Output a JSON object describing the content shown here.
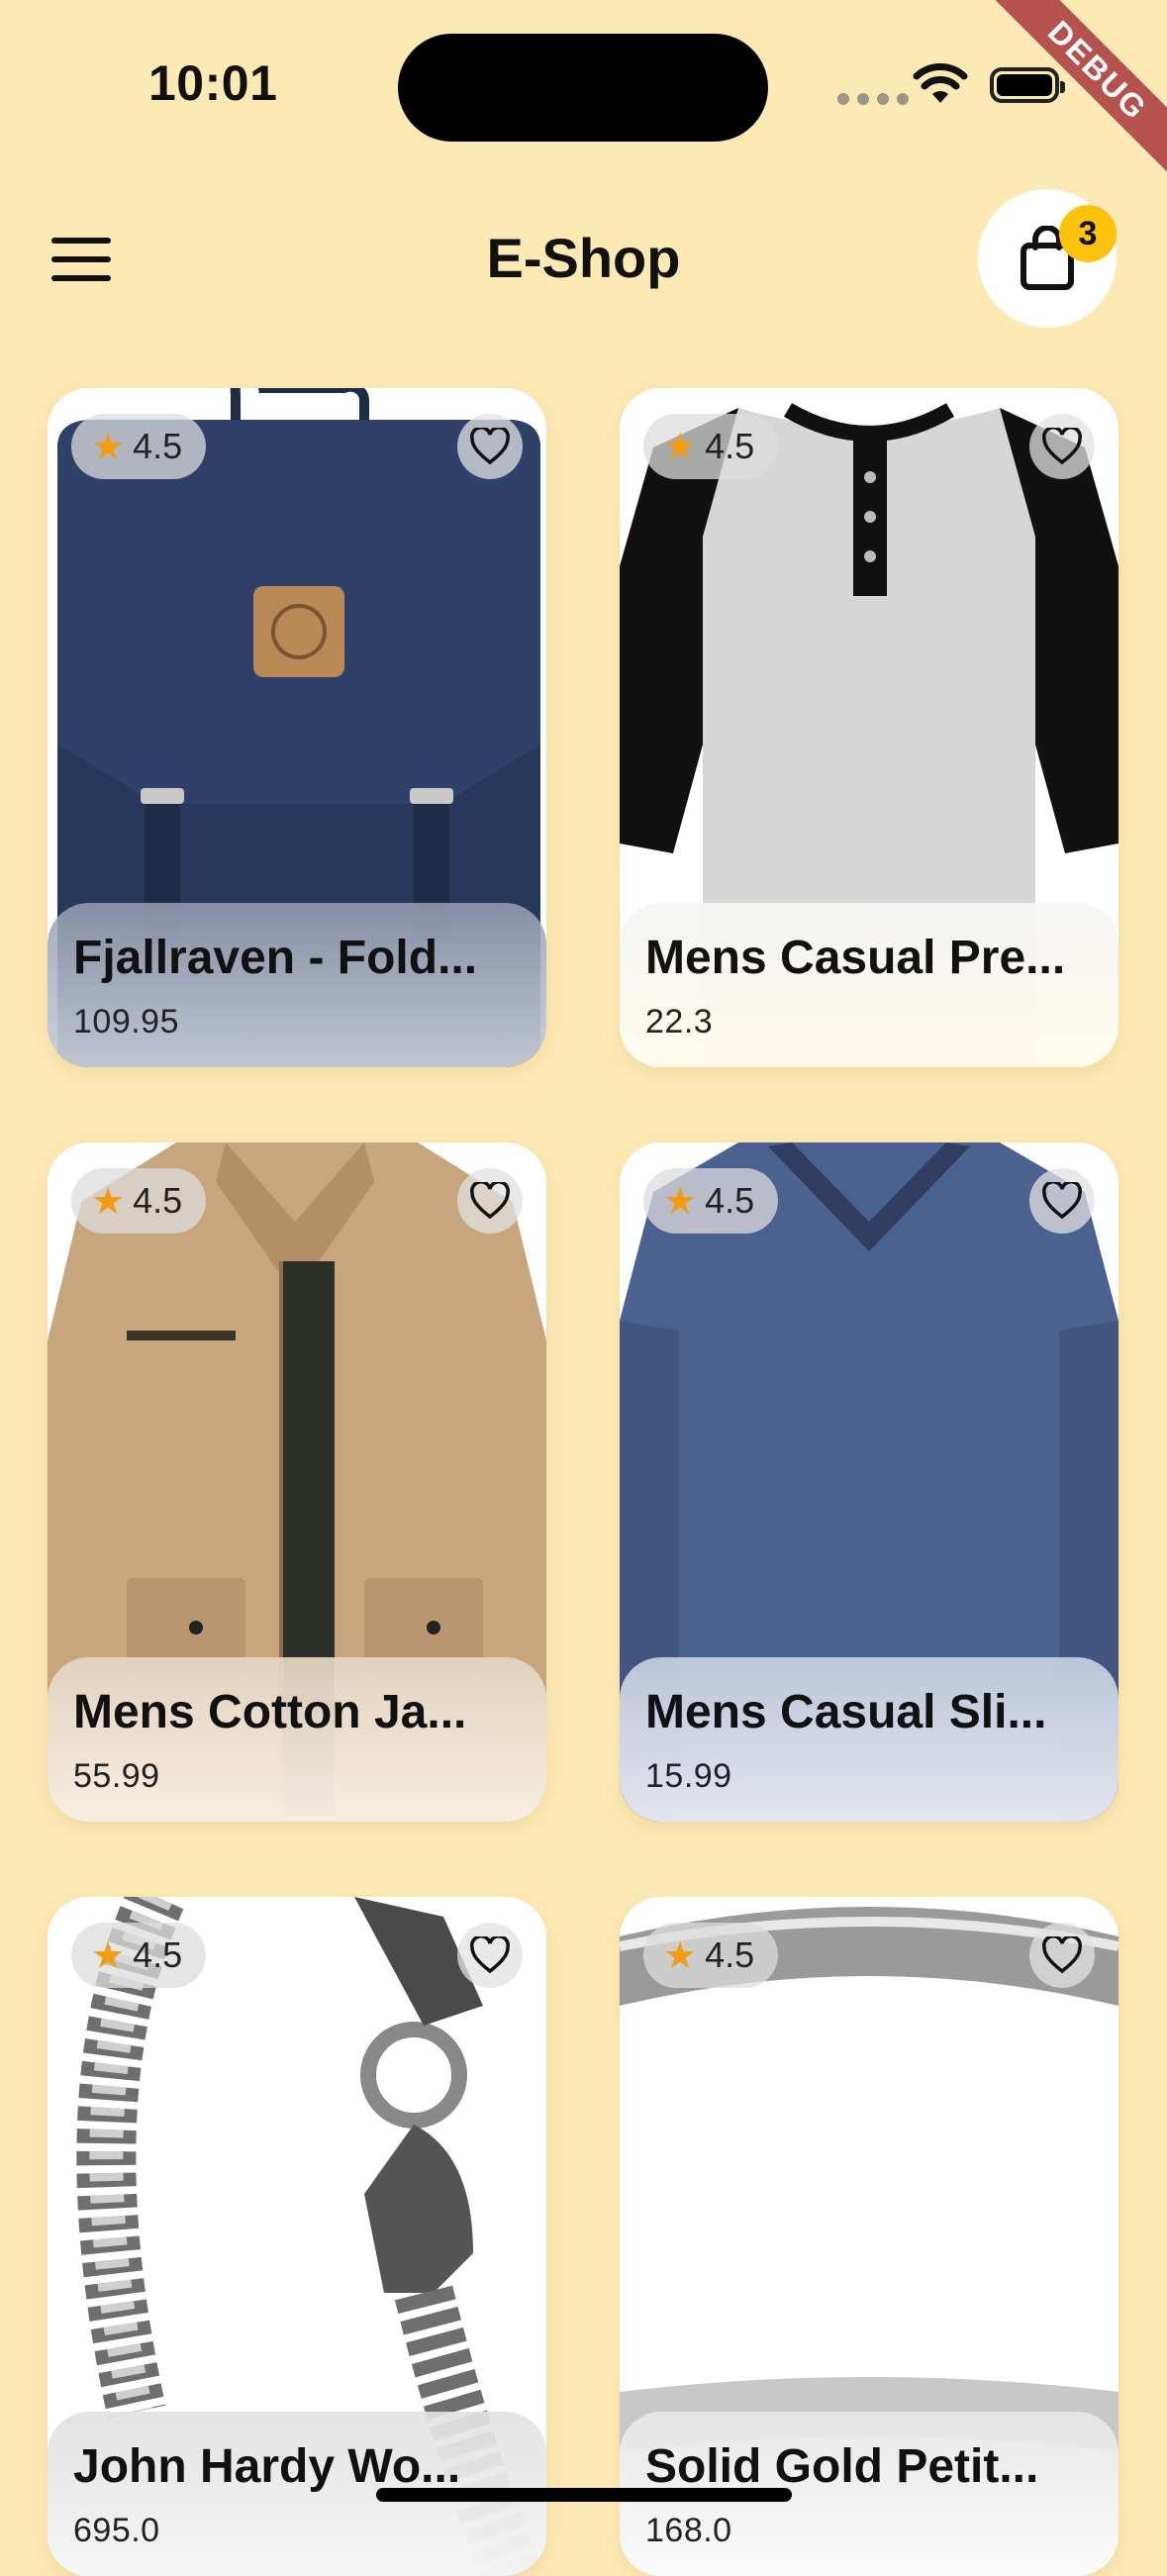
{
  "status": {
    "time": "10:01",
    "debug_label": "DEBUG"
  },
  "header": {
    "title": "E-Shop",
    "cart_count": "3"
  },
  "products": [
    {
      "name": "Fjallraven - Fold...",
      "price": "109.95",
      "rating": "4.5"
    },
    {
      "name": "Mens Casual Pre...",
      "price": "22.3",
      "rating": "4.5"
    },
    {
      "name": "Mens Cotton Ja...",
      "price": "55.99",
      "rating": "4.5"
    },
    {
      "name": "Mens Casual Sli...",
      "price": "15.99",
      "rating": "4.5"
    },
    {
      "name": "John Hardy Wo...",
      "price": "695.0",
      "rating": "4.5"
    },
    {
      "name": "Solid Gold Petit...",
      "price": "168.0",
      "rating": "4.5"
    }
  ],
  "icons": {
    "menu": "menu-icon",
    "cart": "shopping-bag-icon",
    "favorite": "heart-outline-icon",
    "rating": "star-icon"
  },
  "colors": {
    "background": "#fde9b4",
    "badge": "#fcc20c",
    "star": "#f39c12"
  }
}
